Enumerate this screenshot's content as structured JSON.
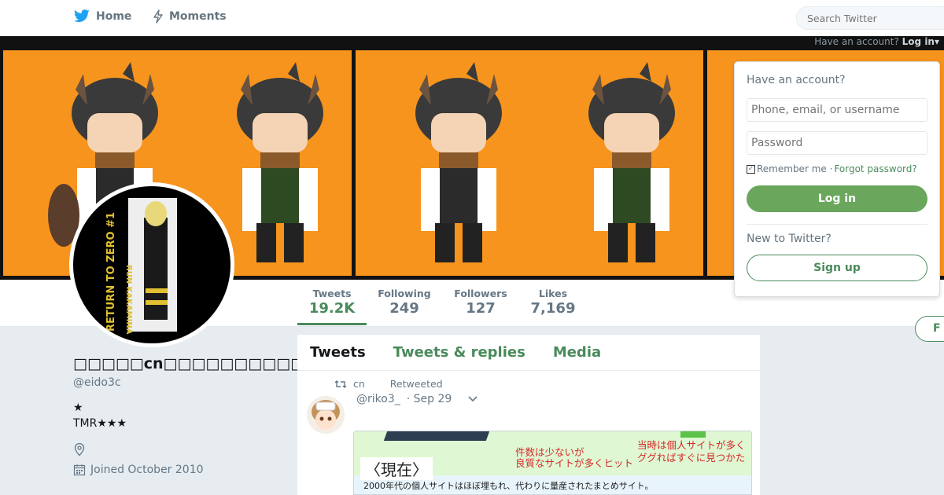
{
  "nav": {
    "home_label": "Home",
    "moments_label": "Moments",
    "search_placeholder": "Search Twitter"
  },
  "banner": {
    "account_prompt": "Have an account?",
    "login_link": "Log in▾"
  },
  "stats": [
    {
      "label": "Tweets",
      "value": "19.2K"
    },
    {
      "label": "Following",
      "value": "249"
    },
    {
      "label": "Followers",
      "value": "127"
    },
    {
      "label": "Likes",
      "value": "7,169"
    }
  ],
  "follow_label": "F",
  "profile": {
    "name": "□□□□□cn□□□□□□□□□□□",
    "handle": "@eido3c",
    "bio_line1": "★",
    "bio_line2": "TMR★★★",
    "joined": "Joined October 2010",
    "avatar_text1": "RETURN TO ZERO #1",
    "avatar_text2": "RUN KAKAMINA"
  },
  "timeline": {
    "tabs": [
      "Tweets",
      "Tweets & replies",
      "Media"
    ],
    "retweet_by": "cn",
    "retweet_label": "Retweeted",
    "tweet_handle": "@riko3_",
    "tweet_date": "· Sep 29",
    "media_heading": "〈現在〉",
    "media_note1": "件数は少ないが\n良質なサイトが多くヒット",
    "media_note2": "当時は個人サイトが多く\nググればすぐに見つかた",
    "media_line": "2000年代の個人サイトはほぼ埋もれ、代わりに量産されたまとめサイト。"
  },
  "login": {
    "question": "Have an account?",
    "user_placeholder": "Phone, email, or username",
    "pass_placeholder": "Password",
    "remember": "Remember me ·",
    "forgot": "Forgot password?",
    "login_button": "Log in",
    "new_question": "New to Twitter?",
    "signup_button": "Sign up"
  },
  "colors": {
    "accent": "#4a8a5c",
    "banner_orange": "#f7941d"
  }
}
